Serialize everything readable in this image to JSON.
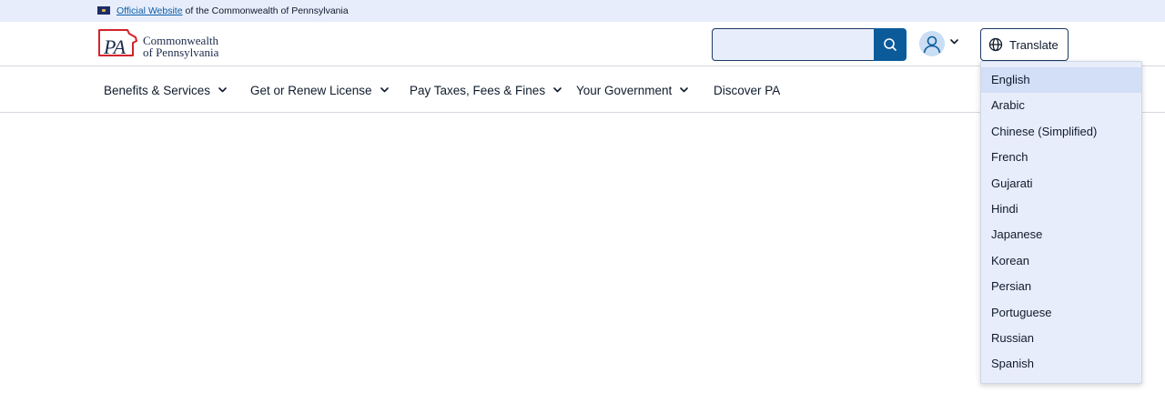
{
  "official_banner": {
    "link_text": "Official Website",
    "suffix": "of the Commonwealth of Pennsylvania"
  },
  "logo": {
    "mark": "PA",
    "line1": "Commonwealth",
    "line2": "of Pennsylvania"
  },
  "search": {
    "value": "",
    "placeholder": ""
  },
  "translate": {
    "label": "Translate"
  },
  "nav": {
    "items": [
      {
        "label": "Benefits & Services",
        "has_dropdown": true
      },
      {
        "label": "Get or Renew License",
        "has_dropdown": true
      },
      {
        "label": "Pay Taxes, Fees & Fines",
        "has_dropdown": true
      },
      {
        "label": "Your Government",
        "has_dropdown": true
      },
      {
        "label": "Discover PA",
        "has_dropdown": false
      }
    ]
  },
  "language_menu": {
    "selected": "English",
    "options": [
      "English",
      "Arabic",
      "Chinese (Simplified)",
      "French",
      "Gujarati",
      "Hindi",
      "Japanese",
      "Korean",
      "Persian",
      "Portuguese",
      "Russian",
      "Spanish"
    ]
  },
  "colors": {
    "banner_bg": "#e8edfb",
    "primary": "#0b5b9b",
    "logo_red": "#d2232a",
    "logo_navy": "#1b2a4a",
    "menu_bg": "#e8edfb",
    "menu_selected": "#d3dff7"
  },
  "icons": {
    "search_button": "search-icon",
    "account": "user-icon",
    "translate": "globe-icon",
    "dropdown": "chevron-down-icon"
  }
}
